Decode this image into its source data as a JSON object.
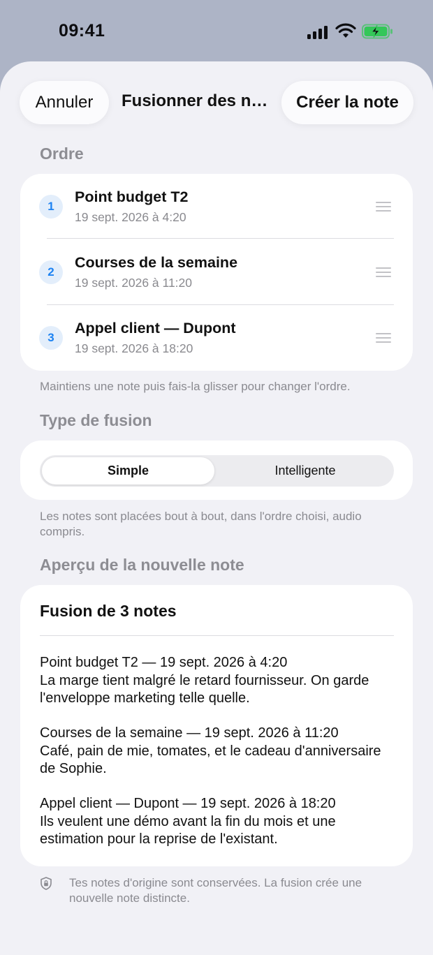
{
  "status_bar": {
    "time": "09:41"
  },
  "header": {
    "cancel_label": "Annuler",
    "title": "Fusionner des notes",
    "create_label": "Créer la note"
  },
  "order": {
    "header": "Ordre",
    "items": [
      {
        "number": "1",
        "title": "Point budget T2",
        "date": "19 sept. 2026 à 4:20"
      },
      {
        "number": "2",
        "title": "Courses de la semaine",
        "date": "19 sept. 2026 à 11:20"
      },
      {
        "number": "3",
        "title": "Appel client — Dupont",
        "date": "19 sept. 2026 à 18:20"
      }
    ],
    "footnote": "Maintiens une note puis fais-la glisser pour changer l'ordre."
  },
  "merge_type": {
    "header": "Type de fusion",
    "options": [
      "Simple",
      "Intelligente"
    ],
    "selected": "Simple",
    "footnote": "Les notes sont placées bout à bout, dans l'ordre choisi, audio compris."
  },
  "preview": {
    "header": "Aperçu de la nouvelle note",
    "title": "Fusion de 3 notes",
    "blocks": [
      {
        "heading": "Point budget T2 — 19 sept. 2026 à 4:20",
        "body": "La marge tient malgré le retard fournisseur. On garde l'enveloppe marketing telle quelle."
      },
      {
        "heading": "Courses de la semaine — 19 sept. 2026 à 11:20",
        "body": "Café, pain de mie, tomates, et le cadeau d'anniversaire de Sophie."
      },
      {
        "heading": "Appel client — Dupont — 19 sept. 2026 à 18:20",
        "body": "Ils veulent une démo avant la fin du mois et une estimation pour la reprise de l'existant."
      }
    ]
  },
  "privacy_note": "Tes notes d'origine sont conservées. La fusion crée une nouvelle note distincte.",
  "colors": {
    "accent": "#1c82f2",
    "badge_bg": "#e3eefb",
    "sheet_bg": "#f1f1f6",
    "backdrop": "#adb4c6",
    "battery_green": "#34c759"
  },
  "icons": [
    "signal-icon",
    "wifi-icon",
    "battery-charging-icon",
    "drag-handle-icon",
    "shield-icon"
  ]
}
